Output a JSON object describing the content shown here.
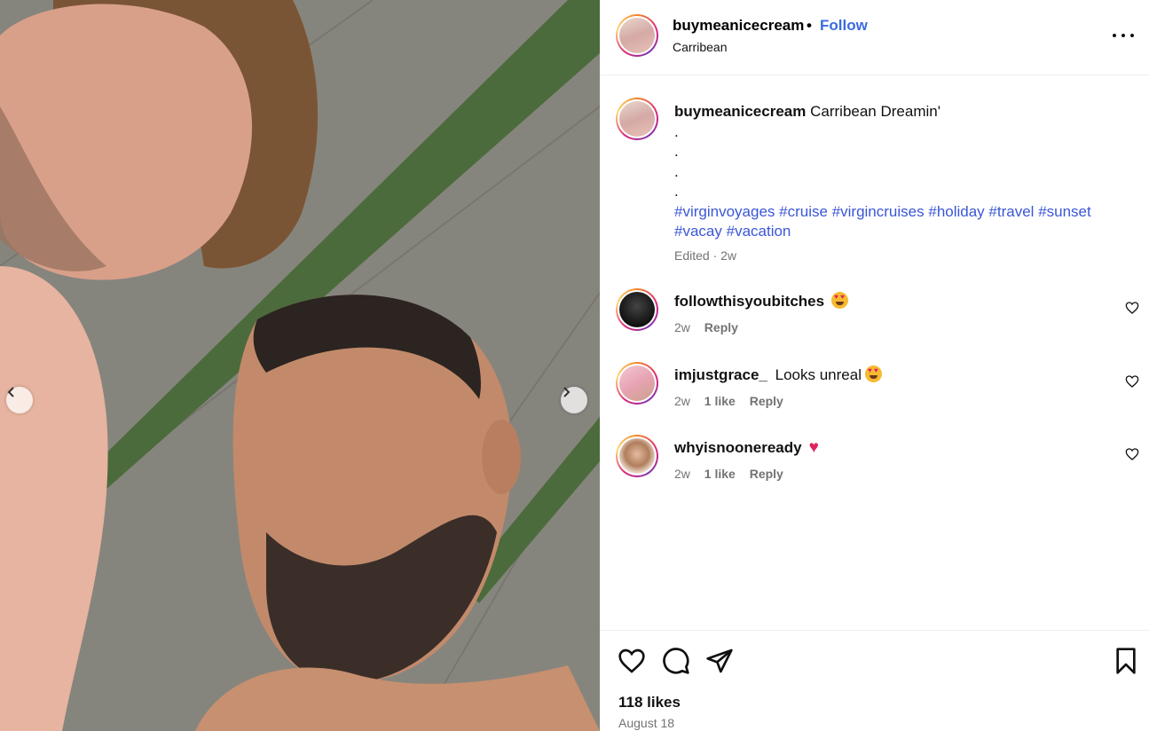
{
  "post": {
    "username": "buymeanicecream",
    "separator": "•",
    "follow_label": "Follow",
    "location": "Carribean",
    "caption_text": "Carribean Dreamin'",
    "caption_dots": [
      ".",
      ".",
      ".",
      "."
    ],
    "hashtags": [
      "#virginvoyages",
      "#cruise",
      "#virgincruises",
      "#holiday",
      "#travel",
      "#sunset",
      "#vacay",
      "#vacation"
    ],
    "edited_label": "Edited · 2w",
    "likes_label": "118 likes",
    "date_label": "August 18"
  },
  "comments": [
    {
      "username": "followthisyoubitches",
      "text": "",
      "emoji": "heart-eyes-emoji",
      "time": "2w",
      "likes": "",
      "reply": "Reply"
    },
    {
      "username": "imjustgrace_",
      "text": "Looks unreal",
      "emoji": "heart-eyes-emoji",
      "time": "2w",
      "likes": "1 like",
      "reply": "Reply"
    },
    {
      "username": "whyisnooneready",
      "text": "",
      "emoji": "pink-heart-emoji",
      "pink_heart_glyph": "♥",
      "time": "2w",
      "likes": "1 like",
      "reply": "Reply"
    }
  ],
  "icons": {
    "like": "heart-icon",
    "comment": "comment-bubble-icon",
    "share": "paper-plane-icon",
    "save": "bookmark-icon",
    "more": "more-options-icon",
    "prev": "chevron-left-icon",
    "next": "chevron-right-icon"
  },
  "colors": {
    "link_blue": "#3b57d6",
    "follow_blue": "#3b6be0",
    "muted_text": "#737373",
    "divider": "#efefef"
  }
}
